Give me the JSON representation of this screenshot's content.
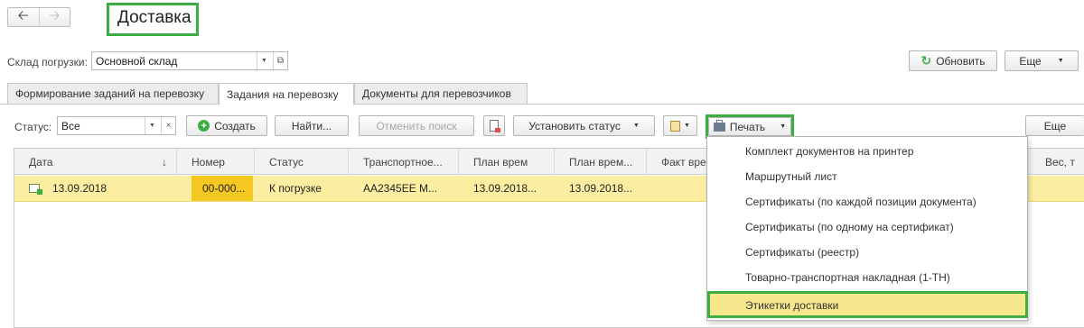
{
  "header": {
    "title": "Доставка"
  },
  "warehouse": {
    "label": "Склад погрузки:",
    "value": "Основной склад"
  },
  "top_buttons": {
    "refresh": "Обновить",
    "more": "Еще"
  },
  "tabs": [
    {
      "label": "Формирование заданий на перевозку"
    },
    {
      "label": "Задания на перевозку"
    },
    {
      "label": "Документы для перевозчиков"
    }
  ],
  "toolbar": {
    "status_label": "Статус:",
    "status_value": "Все",
    "create": "Создать",
    "find": "Найти...",
    "cancel_search": "Отменить поиск",
    "set_status": "Установить статус",
    "print": "Печать",
    "more": "Еще"
  },
  "table": {
    "columns": [
      "Дата",
      "Номер",
      "Статус",
      "Транспортное...",
      "План врем",
      "План врем...",
      "Факт вре",
      "Вес, т"
    ],
    "rows": [
      {
        "date": "13.09.2018",
        "number": "00-000...",
        "status": "К погрузке",
        "transport": "АА2345ЕЕ М...",
        "plan1": "13.09.2018...",
        "plan2": "13.09.2018..."
      }
    ]
  },
  "print_menu": {
    "items": [
      "Комплект документов на принтер",
      "Маршрутный лист",
      "Сертификаты (по каждой позиции документа)",
      "Сертификаты (по одному на сертификат)",
      "Сертификаты (реестр)",
      "Товарно-транспортная накладная (1-ТН)",
      "Этикетки доставки"
    ]
  },
  "colors": {
    "accent_green": "#3cae43",
    "row_highlight": "#fbeea0",
    "number_cell": "#f4c820"
  }
}
